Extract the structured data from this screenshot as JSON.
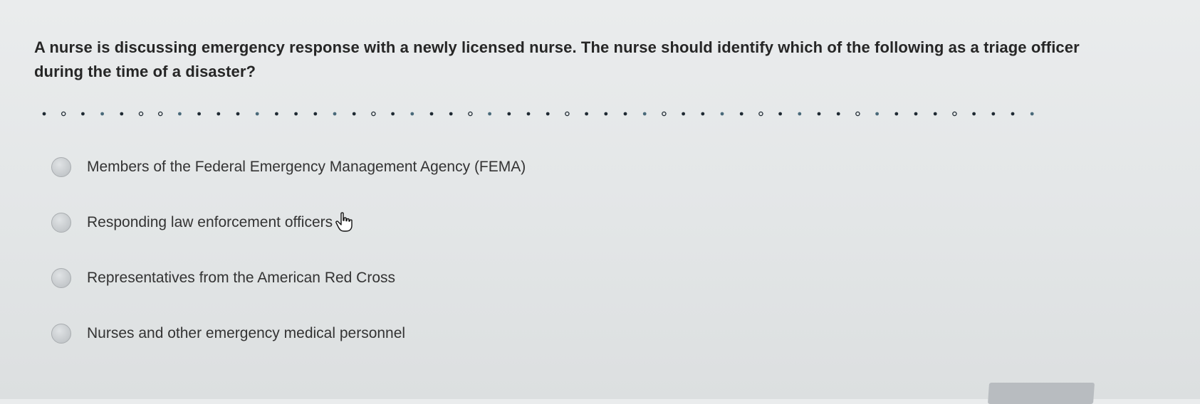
{
  "question": {
    "text": "A nurse is discussing emergency response with a newly licensed nurse. The nurse should identify which of the following as a triage officer during the time of a disaster?"
  },
  "answer_options": [
    {
      "label": "Members of the Federal Emergency Management Agency (FEMA)",
      "selected": false
    },
    {
      "label": "Responding law enforcement officers",
      "selected": false
    },
    {
      "label": "Representatives from the American Red Cross",
      "selected": false
    },
    {
      "label": "Nurses and other emergency medical personnel",
      "selected": false
    }
  ],
  "icons": {
    "cursor": "hand-pointer-icon",
    "radio": "radio-circle-icon"
  },
  "colors": {
    "background": "#e6e8e9",
    "text": "#2b2b2b",
    "radio": "#c4c8cb",
    "dots": "#1f2a33"
  }
}
